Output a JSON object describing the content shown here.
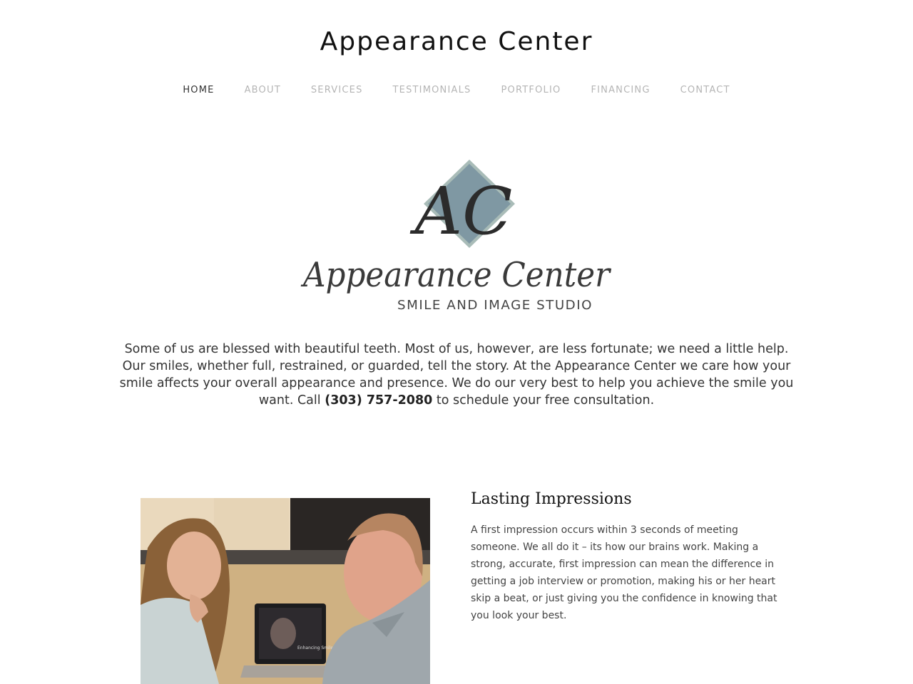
{
  "header": {
    "site_title": "Appearance Center"
  },
  "nav": {
    "items": [
      {
        "label": "HOME",
        "active": true
      },
      {
        "label": "ABOUT",
        "active": false
      },
      {
        "label": "SERVICES",
        "active": false
      },
      {
        "label": "TESTIMONIALS",
        "active": false
      },
      {
        "label": "PORTFOLIO",
        "active": false
      },
      {
        "label": "FINANCING",
        "active": false
      },
      {
        "label": "CONTACT",
        "active": false
      }
    ]
  },
  "logo": {
    "monogram": "AC",
    "script_name": "Appearance Center",
    "tagline": "SMILE AND IMAGE STUDIO",
    "diamond_color": "#7f98a3"
  },
  "intro": {
    "text_before_phone": "Some of us are blessed with beautiful teeth. Most of us, however, are less fortunate; we need a little help. Our smiles, whether full, restrained, or guarded, tell the story. At the Appearance Center we care how your smile affects your overall appearance and presence. We do our very best to help you achieve the smile you want. Call ",
    "phone": "(303) 757-2080",
    "text_after_phone": " to schedule your free consultation."
  },
  "feature": {
    "image_alt": "Woman and dentist reviewing smile images on a laptop",
    "laptop_caption": "Enhancing Smiles",
    "title": "Lasting Impressions",
    "body": "A first impression occurs within 3 seconds of meeting someone. We all do it – its how our brains work. Making a strong, accurate, first impression can mean the difference in getting a job interview or promotion, making his or her heart skip a beat, or just giving you the confidence in knowing that you look your best."
  }
}
